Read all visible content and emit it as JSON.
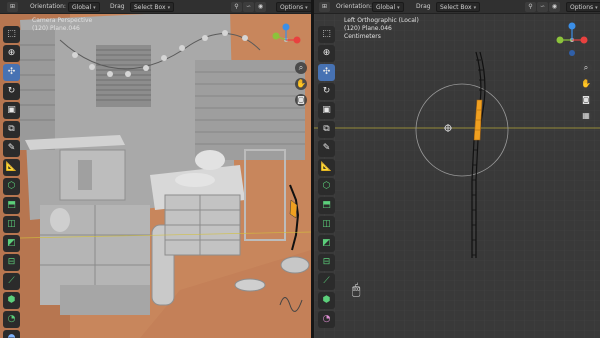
{
  "left_view": {
    "header": {
      "orientation_label": "Orientation:",
      "orientation_value": "Global",
      "drag_label": "Drag",
      "drag_value": "Select Box",
      "options_label": "Options"
    },
    "overlay": {
      "perspective": "Camera Perspective",
      "object": "(120) Plane.046"
    }
  },
  "right_view": {
    "header": {
      "orientation_label": "Orientation:",
      "orientation_value": "Global",
      "drag_label": "Drag",
      "drag_value": "Select Box",
      "options_label": "Options"
    },
    "overlay": {
      "perspective": "Left Orthographic (Local)",
      "object": "(120) Plane.046",
      "units": "Centimeters"
    }
  },
  "toolbar_icons": [
    "select-box-icon",
    "cursor-icon",
    "move-icon",
    "rotate-icon",
    "scale-icon",
    "transform-icon",
    "annotate-icon",
    "measure-icon",
    "add-cube-icon",
    "extrude-icon",
    "inset-icon",
    "bevel-icon",
    "loop-cut-icon",
    "knife-icon",
    "poly-build-icon",
    "spin-icon",
    "smooth-icon",
    "edge-slide-icon",
    "shrink-icon",
    "shear-icon",
    "rip-icon"
  ],
  "colors": {
    "active_tool": "#4772b3",
    "background_orange": "#c8865c",
    "model_gray": "#b9b9b9",
    "selection_orange": "#f0a020",
    "axis_x": "#e8413f",
    "axis_y": "#8cc33b",
    "axis_z": "#3b8fe8"
  }
}
